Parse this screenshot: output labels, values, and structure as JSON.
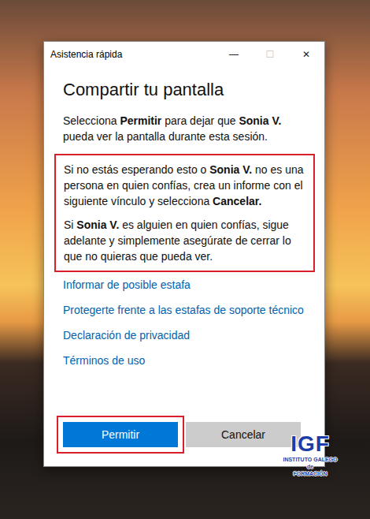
{
  "window": {
    "title": "Asistencia rápida",
    "controls": [
      {
        "glyph": "—",
        "disabled": false
      },
      {
        "glyph": "☐",
        "disabled": true
      },
      {
        "glyph": "✕",
        "disabled": false
      }
    ]
  },
  "heading": "Compartir tu pantalla",
  "intro": [
    {
      "text": "Selecciona ",
      "bold": false
    },
    {
      "text": "Permitir",
      "bold": true
    },
    {
      "text": " para dejar que ",
      "bold": false
    },
    {
      "text": "Sonia V.",
      "bold": true
    },
    {
      "text": " pueda ver la pantalla durante esta sesión.",
      "bold": false
    }
  ],
  "warning": {
    "highlighted": true,
    "paragraphs": [
      [
        {
          "text": "Si no estás esperando esto o ",
          "bold": false
        },
        {
          "text": "Sonia V.",
          "bold": true
        },
        {
          "text": " no es una persona en quien confías, crea un informe con el siguiente vínculo y selecciona ",
          "bold": false
        },
        {
          "text": "Cancelar.",
          "bold": true
        }
      ],
      [
        {
          "text": "Si ",
          "bold": false
        },
        {
          "text": "Sonia V.",
          "bold": true
        },
        {
          "text": " es alguien en quien confías, sigue adelante y simplemente asegúrate de cerrar lo que no quieras que pueda ver.",
          "bold": false
        }
      ]
    ]
  },
  "links": [
    "Informar de posible estafa",
    "Protegerte frente a las estafas de soporte técnico",
    "Declaración de privacidad",
    "Términos de uso"
  ],
  "buttons": [
    {
      "label": "Permitir",
      "primary": true,
      "highlighted": true
    },
    {
      "label": "Cancelar",
      "primary": false,
      "highlighted": false
    }
  ],
  "watermark": {
    "acronym": "IGF",
    "line1": "INSTITUTO GALEGO",
    "small": "de",
    "line2": "FORMACIÓN"
  }
}
